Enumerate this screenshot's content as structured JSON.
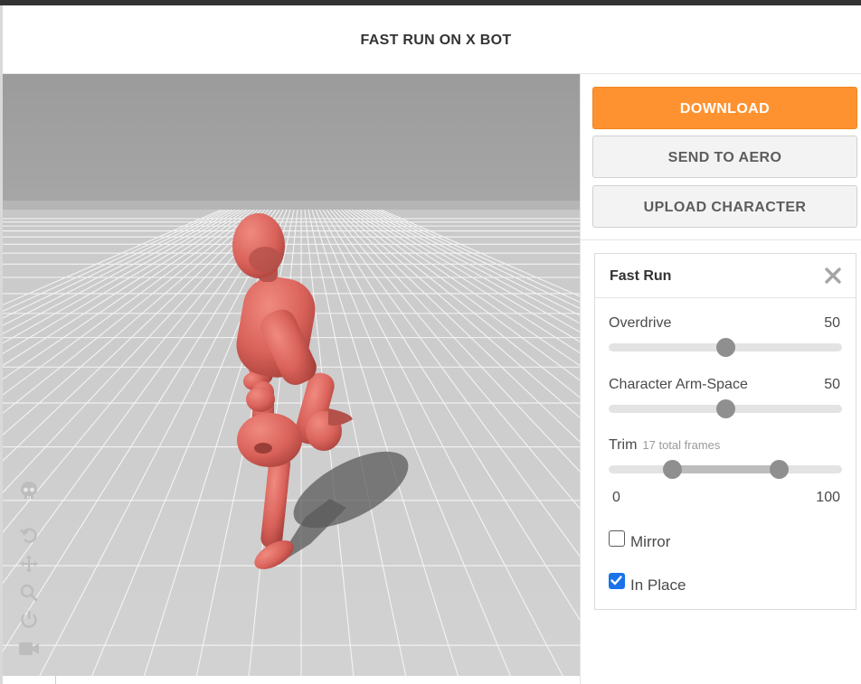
{
  "header": {
    "title": "FAST RUN ON X BOT"
  },
  "viewport": {
    "tools": [
      {
        "icon": "skull-icon"
      },
      {
        "icon": "undo-icon"
      },
      {
        "icon": "move-icon"
      },
      {
        "icon": "zoom-icon"
      },
      {
        "icon": "power-icon"
      },
      {
        "icon": "video-camera-icon"
      }
    ]
  },
  "actions": {
    "download_label": "DOWNLOAD",
    "send_label": "SEND TO AERO",
    "upload_label": "UPLOAD CHARACTER"
  },
  "panel": {
    "title": "Fast Run",
    "close_icon": "close-icon",
    "overdrive": {
      "label": "Overdrive",
      "value": "50",
      "fraction": 0.5
    },
    "arm_space": {
      "label": "Character Arm-Space",
      "value": "50",
      "fraction": 0.5
    },
    "trim": {
      "label": "Trim",
      "subtitle": "17 total frames",
      "min_label": "0",
      "max_label": "100",
      "start_fraction": 0.27,
      "end_fraction": 0.73
    },
    "mirror": {
      "label": "Mirror",
      "checked": false
    },
    "in_place": {
      "label": "In Place",
      "checked": true
    }
  },
  "colors": {
    "accent": "#ff9230",
    "checkbox": "#1a73e8",
    "character": "#e06a62"
  }
}
